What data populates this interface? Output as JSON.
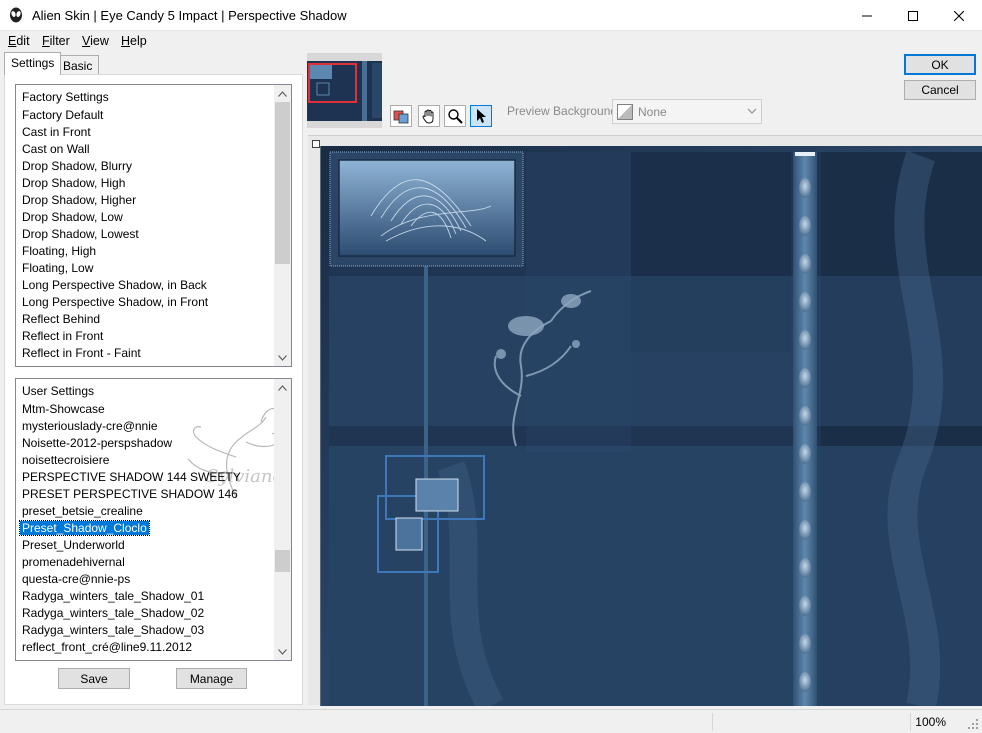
{
  "window": {
    "title": "Alien Skin | Eye Candy 5 Impact | Perspective Shadow"
  },
  "menu": {
    "items": [
      {
        "label": "Edit",
        "mnemonic": "E",
        "rest": "dit"
      },
      {
        "label": "Filter",
        "mnemonic": "F",
        "rest": "ilter"
      },
      {
        "label": "View",
        "mnemonic": "V",
        "rest": "iew"
      },
      {
        "label": "Help",
        "mnemonic": "H",
        "rest": "elp"
      }
    ]
  },
  "tabs": [
    {
      "label": "Settings",
      "active": true
    },
    {
      "label": "Basic",
      "active": false
    }
  ],
  "factory_settings": {
    "header": "Factory Settings",
    "items": [
      "Factory Default",
      "Cast in Front",
      "Cast on Wall",
      "Drop Shadow, Blurry",
      "Drop Shadow, High",
      "Drop Shadow, Higher",
      "Drop Shadow, Low",
      "Drop Shadow, Lowest",
      "Floating, High",
      "Floating, Low",
      "Long Perspective Shadow, in Back",
      "Long Perspective Shadow, in Front",
      "Reflect Behind",
      "Reflect in Front",
      "Reflect in Front - Faint"
    ]
  },
  "user_settings": {
    "header": "User Settings",
    "selected": "Preset_Shadow_Cloclo",
    "items": [
      "Mtm-Showcase",
      "mysteriouslady-cre@nnie",
      "Noisette-2012-perspshadow",
      "noisettecroisiere",
      "PERSPECTIVE SHADOW 144 SWEETY",
      "PRESET PERSPECTIVE SHADOW 146",
      "preset_betsie_crealine",
      "Preset_Shadow_Cloclo",
      "Preset_Underworld",
      "promenadehivernal",
      "questa-cre@nnie-ps",
      "Radyga_winters_tale_Shadow_01",
      "Radyga_winters_tale_Shadow_02",
      "Radyga_winters_tale_Shadow_03",
      "reflect_front_cré@line9.11.2012"
    ],
    "watermark": "Sylviane"
  },
  "buttons": {
    "save": "Save",
    "manage": "Manage",
    "ok": "OK",
    "cancel": "Cancel"
  },
  "preview": {
    "background_label": "Preview Background:",
    "background_value": "None"
  },
  "status": {
    "zoom": "100%"
  },
  "colors": {
    "accent": "#0078d7",
    "preview_dark": "#1b2f4a",
    "preview_mid": "#3d5f83",
    "thumb_highlight": "#e0303a"
  }
}
